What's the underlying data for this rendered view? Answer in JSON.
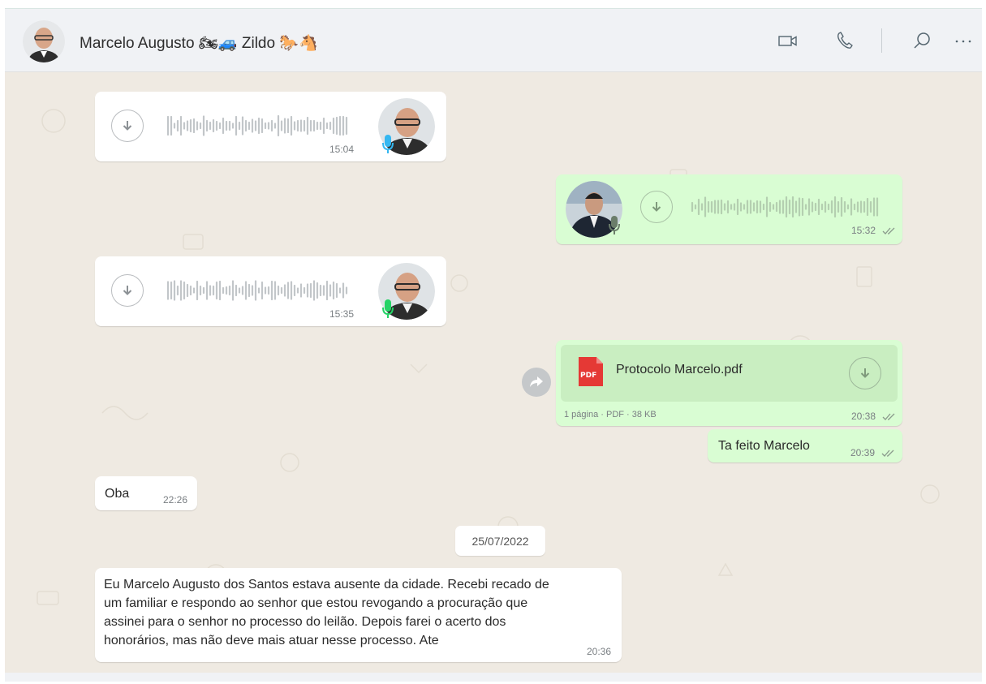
{
  "header": {
    "contact_name": "Marcelo Augusto 🏍🚙 Zildo 🐎🐴",
    "icons": [
      "video-call-icon",
      "voice-call-icon",
      "search-icon",
      "menu-icon"
    ]
  },
  "messages": [
    {
      "type": "audio",
      "direction": "incoming",
      "time": "15:04",
      "mic_color": "#34b7f1"
    },
    {
      "type": "audio",
      "direction": "outgoing",
      "time": "15:32",
      "status": "read"
    },
    {
      "type": "audio",
      "direction": "incoming",
      "time": "15:35",
      "mic_color": "#25d366"
    },
    {
      "type": "document",
      "direction": "outgoing",
      "file_name": "Protocolo Marcelo.pdf",
      "file_badge": "PDF",
      "file_meta": "1 página · PDF · 38 KB",
      "time": "20:38",
      "status": "read"
    },
    {
      "type": "text",
      "direction": "outgoing",
      "text": "Ta feito Marcelo",
      "time": "20:39",
      "status": "read"
    },
    {
      "type": "text",
      "direction": "incoming",
      "text": "Oba",
      "time": "22:26"
    }
  ],
  "date_separator": "25/07/2022",
  "last_message": {
    "direction": "incoming",
    "lines": [
      "Eu Marcelo Augusto dos Santos   estava ausente da cidade.  Recebi recado de",
      "um familiar e respondo ao senhor que estou revogando a procuração que",
      "assinei para o senhor no processo do leilão.   Depois farei o acerto dos",
      "honorários,  mas não deve mais atuar nesse processo.  Ate"
    ],
    "time": "20:36"
  },
  "colors": {
    "incoming_bubble": "#ffffff",
    "outgoing_bubble": "#d9fdd3",
    "chat_background": "#efeae2",
    "header_background": "#f0f2f5",
    "pdf_badge": "#e53935"
  }
}
